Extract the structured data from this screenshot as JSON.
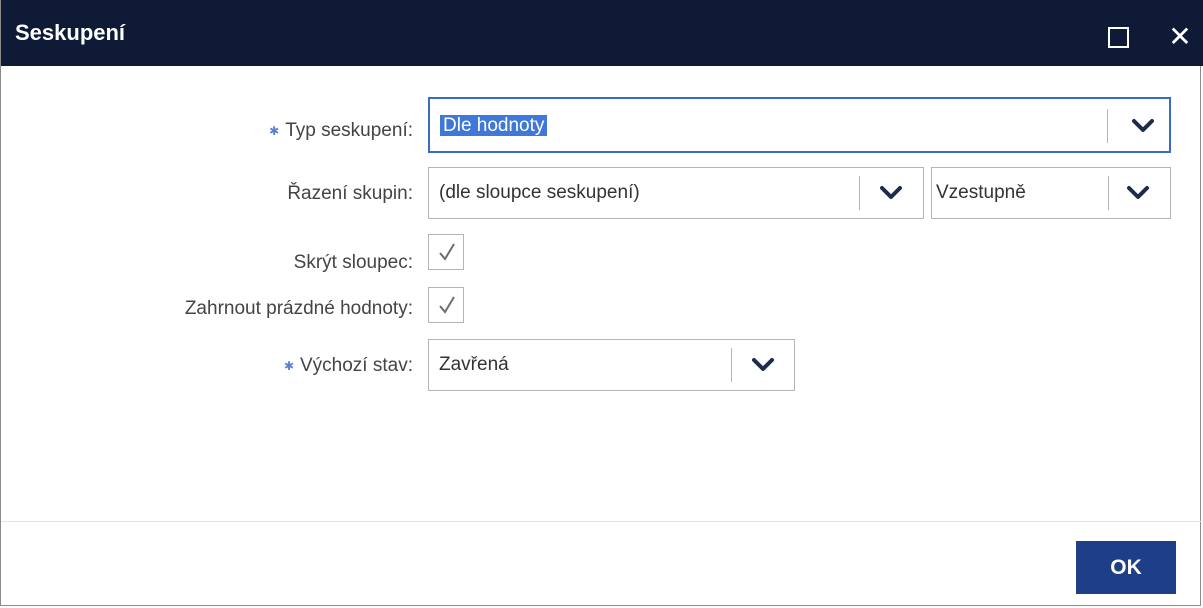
{
  "dialog": {
    "title": "Seskupení",
    "maximize_icon": "maximize-icon",
    "close_icon": "close-icon",
    "close_symbol": "✕"
  },
  "form": {
    "group_type": {
      "label": "Typ seskupení:",
      "value": "Dle hodnoty",
      "required": true
    },
    "group_sort": {
      "label": "Řazení skupin:",
      "value": "(dle sloupce seskupení)",
      "direction": "Vzestupně"
    },
    "hide_column": {
      "label": "Skrýt sloupec:",
      "checked": true
    },
    "include_empty": {
      "label": "Zahrnout prázdné hodnoty:",
      "checked": true
    },
    "default_state": {
      "label": "Výchozí stav:",
      "value": "Zavřená",
      "required": true
    }
  },
  "footer": {
    "ok_label": "OK"
  },
  "colors": {
    "titlebar": "#0e1a36",
    "accent": "#1e3f87",
    "required": "#5b7fcf",
    "selection": "#3f78d8"
  }
}
